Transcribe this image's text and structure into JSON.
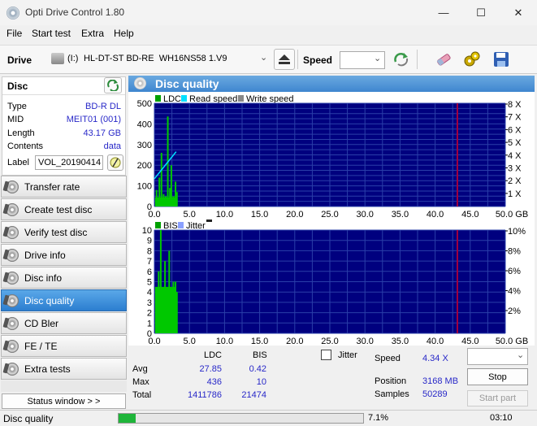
{
  "window": {
    "title": "Opti Drive Control 1.80",
    "min": "—",
    "max": "☐",
    "close": "✕"
  },
  "menu": [
    "File",
    "Start test",
    "Extra",
    "Help"
  ],
  "toolbar": {
    "drive_label": "Drive",
    "drive_letter": "(I:)",
    "drive_name": "HL-DT-ST BD-RE  WH16NS58 1.V9",
    "speed_label": "Speed",
    "speed_value": ""
  },
  "disc": {
    "title": "Disc",
    "rows": [
      {
        "key": "Type",
        "value": "BD-R DL"
      },
      {
        "key": "MID",
        "value": "MEIT01 (001)"
      },
      {
        "key": "Length",
        "value": "43.17 GB"
      },
      {
        "key": "Contents",
        "value": "data"
      }
    ],
    "label_key": "Label",
    "label_value": "VOL_20190414"
  },
  "nav": [
    "Transfer rate",
    "Create test disc",
    "Verify test disc",
    "Drive info",
    "Disc info",
    "Disc quality",
    "CD Bler",
    "FE / TE",
    "Extra tests"
  ],
  "nav_active": 5,
  "status_window_button": "Status window > >",
  "panel_title": "Disc quality",
  "top_legend": [
    "LDC",
    "Read speed",
    "Write speed"
  ],
  "bottom_legend": [
    "BIS",
    "Jitter"
  ],
  "stats": {
    "col_ldc": "LDC",
    "col_bis": "BIS",
    "rows": [
      {
        "label": "Avg",
        "ldc": "27.85",
        "bis": "0.42"
      },
      {
        "label": "Max",
        "ldc": "436",
        "bis": "10"
      },
      {
        "label": "Total",
        "ldc": "1411786",
        "bis": "21474"
      }
    ],
    "jitter_label": "Jitter",
    "speed_label": "Speed",
    "speed_value": "4.34 X",
    "position_label": "Position",
    "position_value": "3168 MB",
    "samples_label": "Samples",
    "samples_value": "50289",
    "stop_button": "Stop",
    "start_part_button": "Start part"
  },
  "status": {
    "text": "Disc quality",
    "progress_text": "7.1%",
    "progress": 0.071,
    "time": "03:10"
  },
  "colors": {
    "plot_bg": "#00007f",
    "grid": "#2a3fa8",
    "ldc": "#00c800",
    "read": "#00e0ff",
    "marker": "#a00040",
    "accent": "#3c82d0"
  },
  "chart_data": [
    {
      "type": "bar",
      "name": "top",
      "x_ticks": [
        "0.0",
        "5.0",
        "10.0",
        "15.0",
        "20.0",
        "25.0",
        "30.0",
        "35.0",
        "40.0",
        "45.0",
        "50.0 GB"
      ],
      "xlim": [
        0,
        50
      ],
      "y_ticks_left": [
        "500",
        "400",
        "300",
        "200",
        "100"
      ],
      "ylim": [
        0,
        500
      ],
      "y_ticks_right": [
        "8 X",
        "7 X",
        "6 X",
        "5 X",
        "4 X",
        "3 X",
        "2 X",
        "1 X"
      ],
      "marker_x": 43.17,
      "series": [
        {
          "name": "LDC",
          "x": [
            0.2,
            0.6,
            0.9,
            1.2,
            1.5,
            1.8,
            2.1,
            2.3,
            2.6,
            2.9,
            3.1
          ],
          "values": [
            80,
            140,
            260,
            60,
            50,
            436,
            90,
            200,
            50,
            120,
            70
          ]
        },
        {
          "name": "Read speed",
          "x": [
            0,
            3.1
          ],
          "values": [
            2.2,
            4.35
          ]
        }
      ]
    },
    {
      "type": "bar",
      "name": "bottom",
      "x_ticks": [
        "0.0",
        "5.0",
        "10.0",
        "15.0",
        "20.0",
        "25.0",
        "30.0",
        "35.0",
        "40.0",
        "45.0",
        "50.0 GB"
      ],
      "xlim": [
        0,
        50
      ],
      "y_ticks_left": [
        "10",
        "9",
        "8",
        "7",
        "6",
        "5",
        "4",
        "3",
        "2",
        "1"
      ],
      "ylim": [
        0,
        10
      ],
      "y_ticks_right": [
        "10%",
        "8%",
        "6%",
        "4%",
        "2%"
      ],
      "marker_x": 43.17,
      "series": [
        {
          "name": "BIS",
          "x": [
            0.2,
            0.5,
            0.8,
            1.1,
            1.4,
            1.7,
            2.0,
            2.3,
            2.6,
            2.9,
            3.1
          ],
          "values": [
            4,
            6,
            10,
            3,
            7,
            2,
            8,
            4,
            5,
            5,
            4
          ]
        }
      ]
    }
  ]
}
